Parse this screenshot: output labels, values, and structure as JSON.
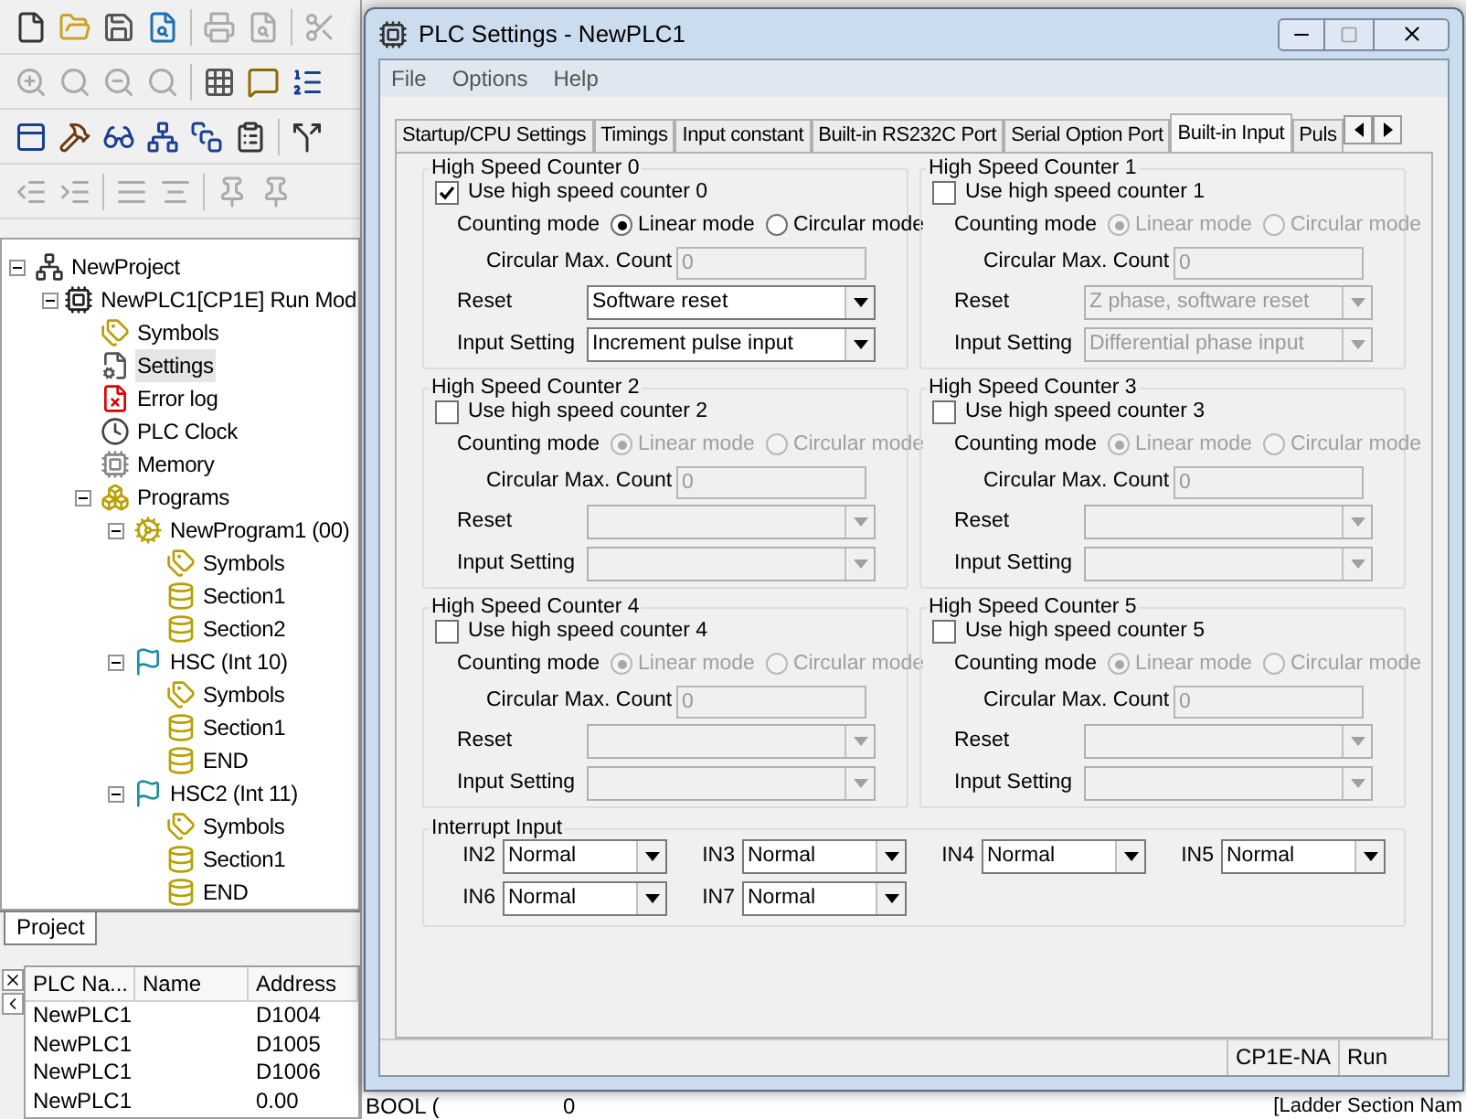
{
  "tree": {
    "label": "NewProject",
    "kind": "project",
    "selected": false,
    "expanded": true,
    "children": [
      {
        "label": "NewPLC1[CP1E] Run Mod",
        "kind": "plc",
        "selected": false,
        "expanded": true,
        "children": [
          {
            "label": "Symbols",
            "kind": "symbols",
            "selected": false
          },
          {
            "label": "Settings",
            "kind": "settings",
            "selected": true
          },
          {
            "label": "Error log",
            "kind": "errorlog",
            "selected": false
          },
          {
            "label": "PLC Clock",
            "kind": "clock",
            "selected": false
          },
          {
            "label": "Memory",
            "kind": "memory",
            "selected": false
          },
          {
            "label": "Programs",
            "kind": "programs",
            "selected": false,
            "expanded": true,
            "children": [
              {
                "label": "NewProgram1 (00)",
                "kind": "program",
                "selected": false,
                "expanded": true,
                "children": [
                  {
                    "label": "Symbols",
                    "kind": "symbols",
                    "selected": false
                  },
                  {
                    "label": "Section1",
                    "kind": "section",
                    "selected": false
                  },
                  {
                    "label": "Section2",
                    "kind": "section",
                    "selected": false
                  }
                ]
              },
              {
                "label": "HSC (Int 10)",
                "kind": "task",
                "selected": false,
                "expanded": true,
                "children": [
                  {
                    "label": "Symbols",
                    "kind": "symbols",
                    "selected": false
                  },
                  {
                    "label": "Section1",
                    "kind": "section",
                    "selected": false
                  },
                  {
                    "label": "END",
                    "kind": "section",
                    "selected": false
                  }
                ]
              },
              {
                "label": "HSC2 (Int 11)",
                "kind": "task",
                "selected": false,
                "expanded": true,
                "children": [
                  {
                    "label": "Symbols",
                    "kind": "symbols",
                    "selected": false
                  },
                  {
                    "label": "Section1",
                    "kind": "section",
                    "selected": false
                  },
                  {
                    "label": "END",
                    "kind": "section",
                    "selected": false
                  }
                ]
              }
            ]
          }
        ]
      }
    ]
  },
  "project_tab": {
    "label": "Project"
  },
  "table": {
    "columns": [
      "PLC Na...",
      "Name",
      "Address"
    ],
    "rows": [
      {
        "plc_name": "NewPLC1",
        "address": "D1004"
      },
      {
        "plc_name": "NewPLC1",
        "address": "D1005"
      },
      {
        "plc_name": "NewPLC1",
        "address": "D1006"
      },
      {
        "plc_name": "NewPLC1",
        "address": "0.00",
        "column_4": "BOOL (",
        "column_5": "0"
      }
    ]
  },
  "ladder_panel_text": "[Ladder Section Nam",
  "dialog": {
    "title": "PLC Settings - NewPLC1",
    "menu": [
      "File",
      "Options",
      "Help"
    ],
    "tabs": [
      {
        "label": "Startup/CPU Settings",
        "selected": false
      },
      {
        "label": "Timings",
        "selected": false
      },
      {
        "label": "Input constant",
        "selected": false
      },
      {
        "label": "Built-in RS232C Port",
        "selected": false
      },
      {
        "label": "Serial Option Port",
        "selected": false
      },
      {
        "label": "Built-in Input",
        "selected": true
      },
      {
        "label": "Puls",
        "selected": false
      }
    ],
    "counters": [
      {
        "title": "High Speed Counter 0",
        "use_label": "Use high speed counter 0",
        "checked": true,
        "mode_label": "Counting mode",
        "modes": [
          {
            "label": "Linear mode",
            "selected": true
          },
          {
            "label": "Circular mode",
            "selected": false
          }
        ],
        "max_label": "Circular Max. Count",
        "max_value": "0",
        "reset_label": "Reset",
        "reset_value": "Software reset",
        "input_label": "Input Setting",
        "input_value": "Increment pulse input"
      },
      {
        "title": "High Speed Counter 1",
        "use_label": "Use high speed counter 1",
        "checked": false,
        "mode_label": "Counting mode",
        "modes": [
          {
            "label": "Linear mode",
            "selected": true
          },
          {
            "label": "Circular mode",
            "selected": false
          }
        ],
        "max_label": "Circular Max. Count",
        "max_value": "0",
        "reset_label": "Reset",
        "reset_value": "Z phase, software reset",
        "input_label": "Input Setting",
        "input_value": "Differential phase input"
      },
      {
        "title": "High Speed Counter 2",
        "use_label": "Use high speed counter 2",
        "checked": false,
        "mode_label": "Counting mode",
        "modes": [
          {
            "label": "Linear mode",
            "selected": true
          },
          {
            "label": "Circular mode",
            "selected": false
          }
        ],
        "max_label": "Circular Max. Count",
        "max_value": "0",
        "reset_label": "Reset",
        "input_label": "Input Setting"
      },
      {
        "title": "High Speed Counter 3",
        "use_label": "Use high speed counter 3",
        "checked": false,
        "mode_label": "Counting mode",
        "modes": [
          {
            "label": "Linear mode",
            "selected": true
          },
          {
            "label": "Circular mode",
            "selected": false
          }
        ],
        "max_label": "Circular Max. Count",
        "max_value": "0",
        "reset_label": "Reset",
        "input_label": "Input Setting"
      },
      {
        "title": "High Speed Counter 4",
        "use_label": "Use high speed counter 4",
        "checked": false,
        "mode_label": "Counting mode",
        "modes": [
          {
            "label": "Linear mode",
            "selected": true
          },
          {
            "label": "Circular mode",
            "selected": false
          }
        ],
        "max_label": "Circular Max. Count",
        "max_value": "0",
        "reset_label": "Reset",
        "input_label": "Input Setting"
      },
      {
        "title": "High Speed Counter 5",
        "use_label": "Use high speed counter 5",
        "checked": false,
        "mode_label": "Counting mode",
        "modes": [
          {
            "label": "Linear mode",
            "selected": true
          },
          {
            "label": "Circular mode",
            "selected": false
          }
        ],
        "max_label": "Circular Max. Count",
        "max_value": "0",
        "reset_label": "Reset",
        "input_label": "Input Setting"
      }
    ],
    "interrupt": {
      "title": "Interrupt Input",
      "inputs": [
        {
          "label": "IN2",
          "value": "Normal"
        },
        {
          "label": "IN3",
          "value": "Normal"
        },
        {
          "label": "IN4",
          "value": "Normal"
        },
        {
          "label": "IN5",
          "value": "Normal"
        },
        {
          "label": "IN6",
          "value": "Normal"
        },
        {
          "label": "IN7",
          "value": "Normal"
        }
      ]
    },
    "status_bar": [
      "CP1E-NA",
      "Run"
    ]
  }
}
